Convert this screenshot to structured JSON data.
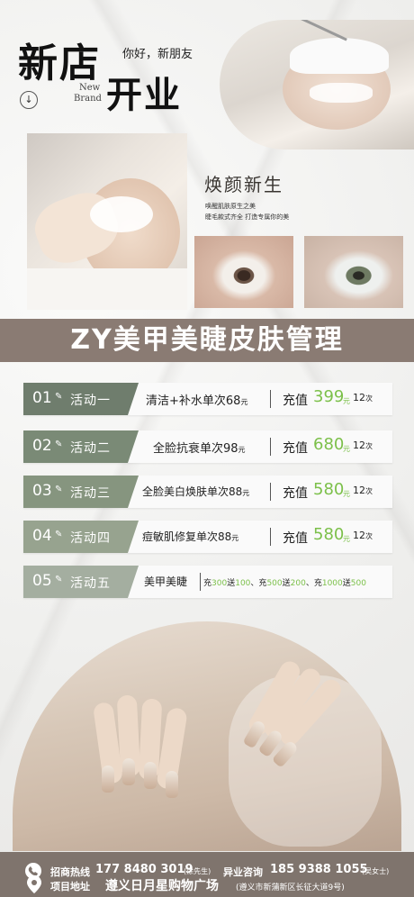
{
  "header": {
    "title_line1": "新店",
    "title_line2": "开业",
    "greeting": "你好，新朋友",
    "sub_en_1": "New",
    "sub_en_2": "Brand",
    "arrow": "↓"
  },
  "feature": {
    "title": "焕颜新生",
    "line1": "唤醒肌肤原生之美",
    "line2": "睫毛款式齐全  打造专属你的美"
  },
  "brand_banner": "ZY美甲美睫皮肤管理",
  "activities": [
    {
      "num": "01",
      "icon": "✎",
      "label": "活动一",
      "item": "清洁+补水单次68",
      "item_unit": "元",
      "charge": "充值",
      "price": "399",
      "price_unit": "元",
      "times": "12",
      "times_unit": "次",
      "tag_color": "#6f7d6d"
    },
    {
      "num": "02",
      "icon": "✎",
      "label": "活动二",
      "item": "全脸抗衰单次98",
      "item_unit": "元",
      "charge": "充值",
      "price": "680",
      "price_unit": "元",
      "times": "12",
      "times_unit": "次",
      "tag_color": "#7a8a76"
    },
    {
      "num": "03",
      "icon": "✎",
      "label": "活动三",
      "item": "全脸美白焕肤单次88",
      "item_unit": "元",
      "charge": "充值",
      "price": "580",
      "price_unit": "元",
      "times": "12",
      "times_unit": "次",
      "tag_color": "#86957f"
    },
    {
      "num": "04",
      "icon": "✎",
      "label": "活动四",
      "item": "痘敏肌修复单次88",
      "item_unit": "元",
      "charge": "充值",
      "price": "580",
      "price_unit": "元",
      "times": "12",
      "times_unit": "次",
      "tag_color": "#97a38f"
    },
    {
      "num": "05",
      "icon": "✎",
      "label": "活动五",
      "item": "美甲美睫",
      "promo": [
        {
          "a": "充",
          "v1": "300",
          "b": "送",
          "v2": "100",
          "c": "、"
        },
        {
          "a": "充",
          "v1": "500",
          "b": "送",
          "v2": "200",
          "c": "、"
        },
        {
          "a": "充",
          "v1": "1000",
          "b": "送",
          "v2": "500",
          "c": ""
        }
      ],
      "tag_color": "#a4aea0"
    }
  ],
  "footer": {
    "hotline_label": "招商热线",
    "hotline_num": "177 8480 3019",
    "hotline_name": "(涂先生)",
    "consult_label": "异业咨询",
    "consult_num": "185 9388 1055",
    "consult_name": "(吴女士)",
    "addr_label": "项目地址",
    "addr_main": "遵义日月星购物广场",
    "addr_detail": "(遵义市新蒲新区长征大道9号)",
    "phone_icon": "phone-icon",
    "pin_icon": "location-pin-icon"
  },
  "colors": {
    "accent_green": "#7cc04a",
    "banner_brown": "#8a7b73",
    "footer_brown": "#7f746d"
  }
}
